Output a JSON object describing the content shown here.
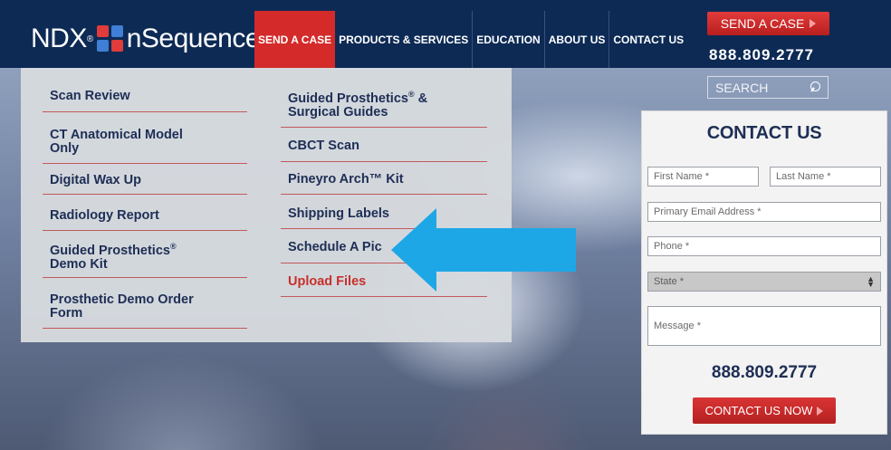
{
  "brand": {
    "logo_left": "NDX",
    "logo_reg": "®",
    "logo_right": "nSequence"
  },
  "nav": {
    "items": [
      "SEND A CASE",
      "PRODUCTS & SERVICES",
      "EDUCATION",
      "ABOUT US",
      "CONTACT US"
    ],
    "active_index": 0
  },
  "header": {
    "cta_label": "SEND A CASE",
    "phone": "888.809.2777",
    "search_placeholder": "SEARCH"
  },
  "dropdown": {
    "left": [
      {
        "line1": "Scan Review",
        "line2": ""
      },
      {
        "line1": "CT Anatomical Model",
        "line2": "Only"
      },
      {
        "line1": "Digital Wax Up",
        "line2": ""
      },
      {
        "line1": "Radiology Report",
        "line2": ""
      },
      {
        "line1": "Guided Prosthetics",
        "sup": "®",
        "line2": "Demo Kit"
      },
      {
        "line1": "Prosthetic Demo Order",
        "line2": "Form"
      }
    ],
    "right": [
      {
        "line1": "Guided Prosthetics",
        "sup": "®",
        "line1_suffix": " &",
        "line2": "Surgical Guides"
      },
      {
        "line1": "CBCT Scan",
        "line2": ""
      },
      {
        "line1": "Pineyro Arch™ Kit",
        "line2": ""
      },
      {
        "line1": "Shipping Labels",
        "line2": ""
      },
      {
        "line1": "Schedule A Pic",
        "line2": ""
      },
      {
        "line1": "Upload Files",
        "line2": ""
      }
    ]
  },
  "contact_form": {
    "title": "CONTACT US",
    "first_name": "First Name *",
    "last_name": "Last Name *",
    "email": "Primary Email Address *",
    "phone": "Phone *",
    "state": "State *",
    "message": "Message *",
    "phone_display": "888.809.2777",
    "submit_label": "CONTACT US NOW"
  },
  "colors": {
    "navy": "#0d2a55",
    "red": "#d42a2a",
    "arrow": "#1ea7e6",
    "menu_text": "#1e2e55"
  }
}
